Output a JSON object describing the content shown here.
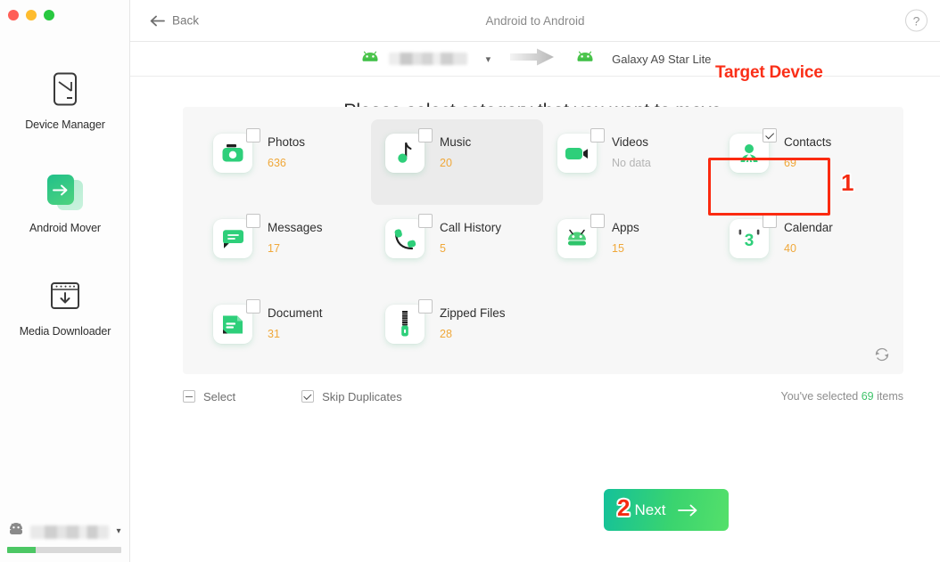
{
  "window": {
    "traffic_lights": [
      "close",
      "minimize",
      "zoom"
    ]
  },
  "sidebar": {
    "items": [
      {
        "label": "Device Manager",
        "icon": "phone-outline-icon"
      },
      {
        "label": "Android Mover",
        "icon": "android-mover-icon"
      },
      {
        "label": "Media Downloader",
        "icon": "media-downloader-icon"
      }
    ],
    "device_status": {
      "name": "",
      "name_redacted": true,
      "storage_percent": 25
    }
  },
  "header": {
    "back_label": "Back",
    "title": "Android to Android",
    "help_label": "?"
  },
  "device_bar": {
    "source_name": "",
    "source_redacted": true,
    "target_name": "Galaxy A9 Star Lite",
    "annotation": "Target Device"
  },
  "main": {
    "heading": "Please select category that you want to move."
  },
  "categories": [
    {
      "name": "Photos",
      "count": "636",
      "icon": "camera-icon",
      "checked": false,
      "hover": false,
      "no_data": false
    },
    {
      "name": "Music",
      "count": "20",
      "icon": "music-note-icon",
      "checked": false,
      "hover": true,
      "no_data": false
    },
    {
      "name": "Videos",
      "count": "No data",
      "icon": "video-icon",
      "checked": false,
      "hover": false,
      "no_data": true
    },
    {
      "name": "Contacts",
      "count": "69",
      "icon": "contact-icon",
      "checked": true,
      "hover": false,
      "no_data": false
    },
    {
      "name": "Messages",
      "count": "17",
      "icon": "message-icon",
      "checked": false,
      "hover": false,
      "no_data": false
    },
    {
      "name": "Call History",
      "count": "5",
      "icon": "phone-call-icon",
      "checked": false,
      "hover": false,
      "no_data": false
    },
    {
      "name": "Apps",
      "count": "15",
      "icon": "android-icon",
      "checked": false,
      "hover": false,
      "no_data": false
    },
    {
      "name": "Calendar",
      "count": "40",
      "icon": "calendar-icon",
      "checked": false,
      "hover": false,
      "no_data": false
    },
    {
      "name": "Document",
      "count": "31",
      "icon": "document-icon",
      "checked": false,
      "hover": false,
      "no_data": false
    },
    {
      "name": "Zipped Files",
      "count": "28",
      "icon": "zip-icon",
      "checked": false,
      "hover": false,
      "no_data": false
    }
  ],
  "controls": {
    "select_label": "Select",
    "select_state": "indeterminate",
    "skip_duplicates_label": "Skip Duplicates",
    "skip_duplicates_checked": true,
    "selected_prefix": "You've selected",
    "selected_count": "69",
    "selected_suffix": "items",
    "refresh_icon": "refresh-icon"
  },
  "footer": {
    "next_label": "Next"
  },
  "annotations": {
    "step_one": "1",
    "step_two": "2"
  },
  "colors": {
    "accent_green": "#3fc36a",
    "count_orange": "#f0a83a",
    "annotation_red": "#fa2f18",
    "button_gradient_start": "#14c19a",
    "button_gradient_end": "#55e06a"
  }
}
